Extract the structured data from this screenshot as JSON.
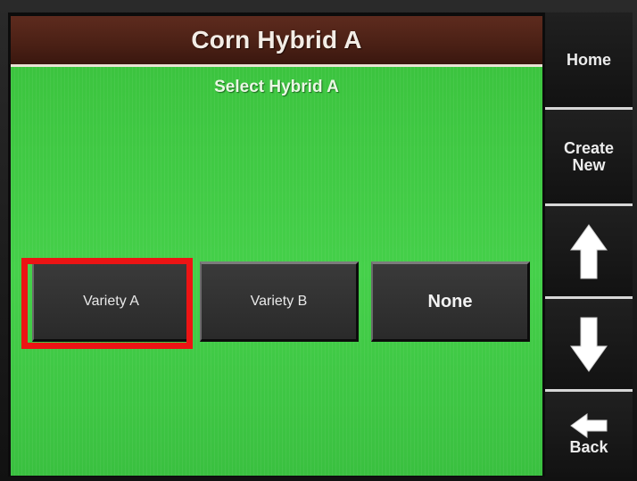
{
  "header": {
    "title": "Corn Hybrid A"
  },
  "main": {
    "subtitle": "Select Hybrid A",
    "options": [
      {
        "label": "Variety A",
        "selected": true
      },
      {
        "label": "Variety B",
        "selected": false
      },
      {
        "label": "None",
        "selected": false
      }
    ]
  },
  "sidebar": {
    "home_label": "Home",
    "create_new_label": "Create\nNew",
    "up_icon": "arrow-up-icon",
    "down_icon": "arrow-down-icon",
    "back_icon": "arrow-left-icon",
    "back_label": "Back"
  },
  "colors": {
    "header_bg": "#4a2015",
    "panel_green": "#45d04a",
    "button_bg": "#2e2e2e",
    "highlight": "#ec1414"
  }
}
